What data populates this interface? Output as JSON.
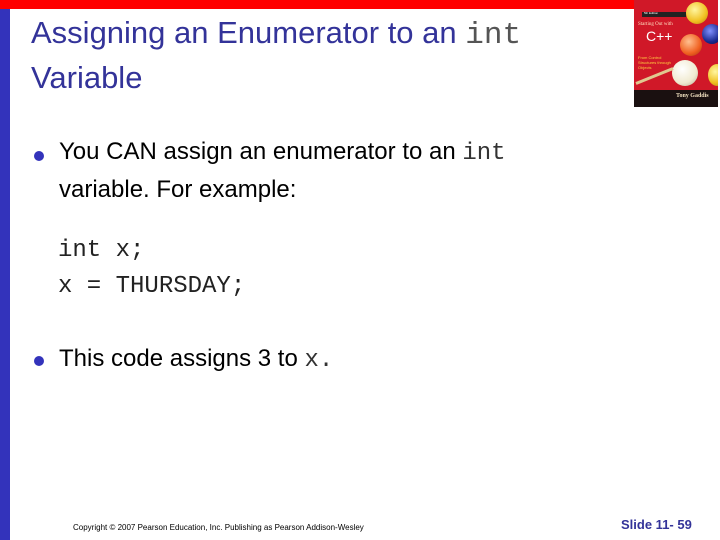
{
  "slide": {
    "title": {
      "text_before": "Assigning an Enumerator to an ",
      "code": "int",
      "text_after": "Variable"
    },
    "bullets": [
      {
        "text_before": "You CAN assign an enumerator to an ",
        "code": "int",
        "text_after": "variable. For example:"
      },
      {
        "text_before": "This code assigns 3 to ",
        "code": "x.",
        "text_after": ""
      }
    ],
    "code_lines": [
      "int x;",
      "x = THURSDAY;"
    ],
    "footer": {
      "copyright": "Copyright © 2007 Pearson Education, Inc. Publishing as Pearson Addison-Wesley",
      "slide_number": "Slide 11- 59"
    },
    "book_cover": {
      "edition": "5th Edition",
      "series": "Starting Out with",
      "language": "C++",
      "subtitle": "From Control Structures through Objects",
      "author": "Tony Gaddis"
    }
  },
  "colors": {
    "accent_red": "#ff0000",
    "accent_blue": "#3333bb",
    "title_color": "#333399"
  }
}
